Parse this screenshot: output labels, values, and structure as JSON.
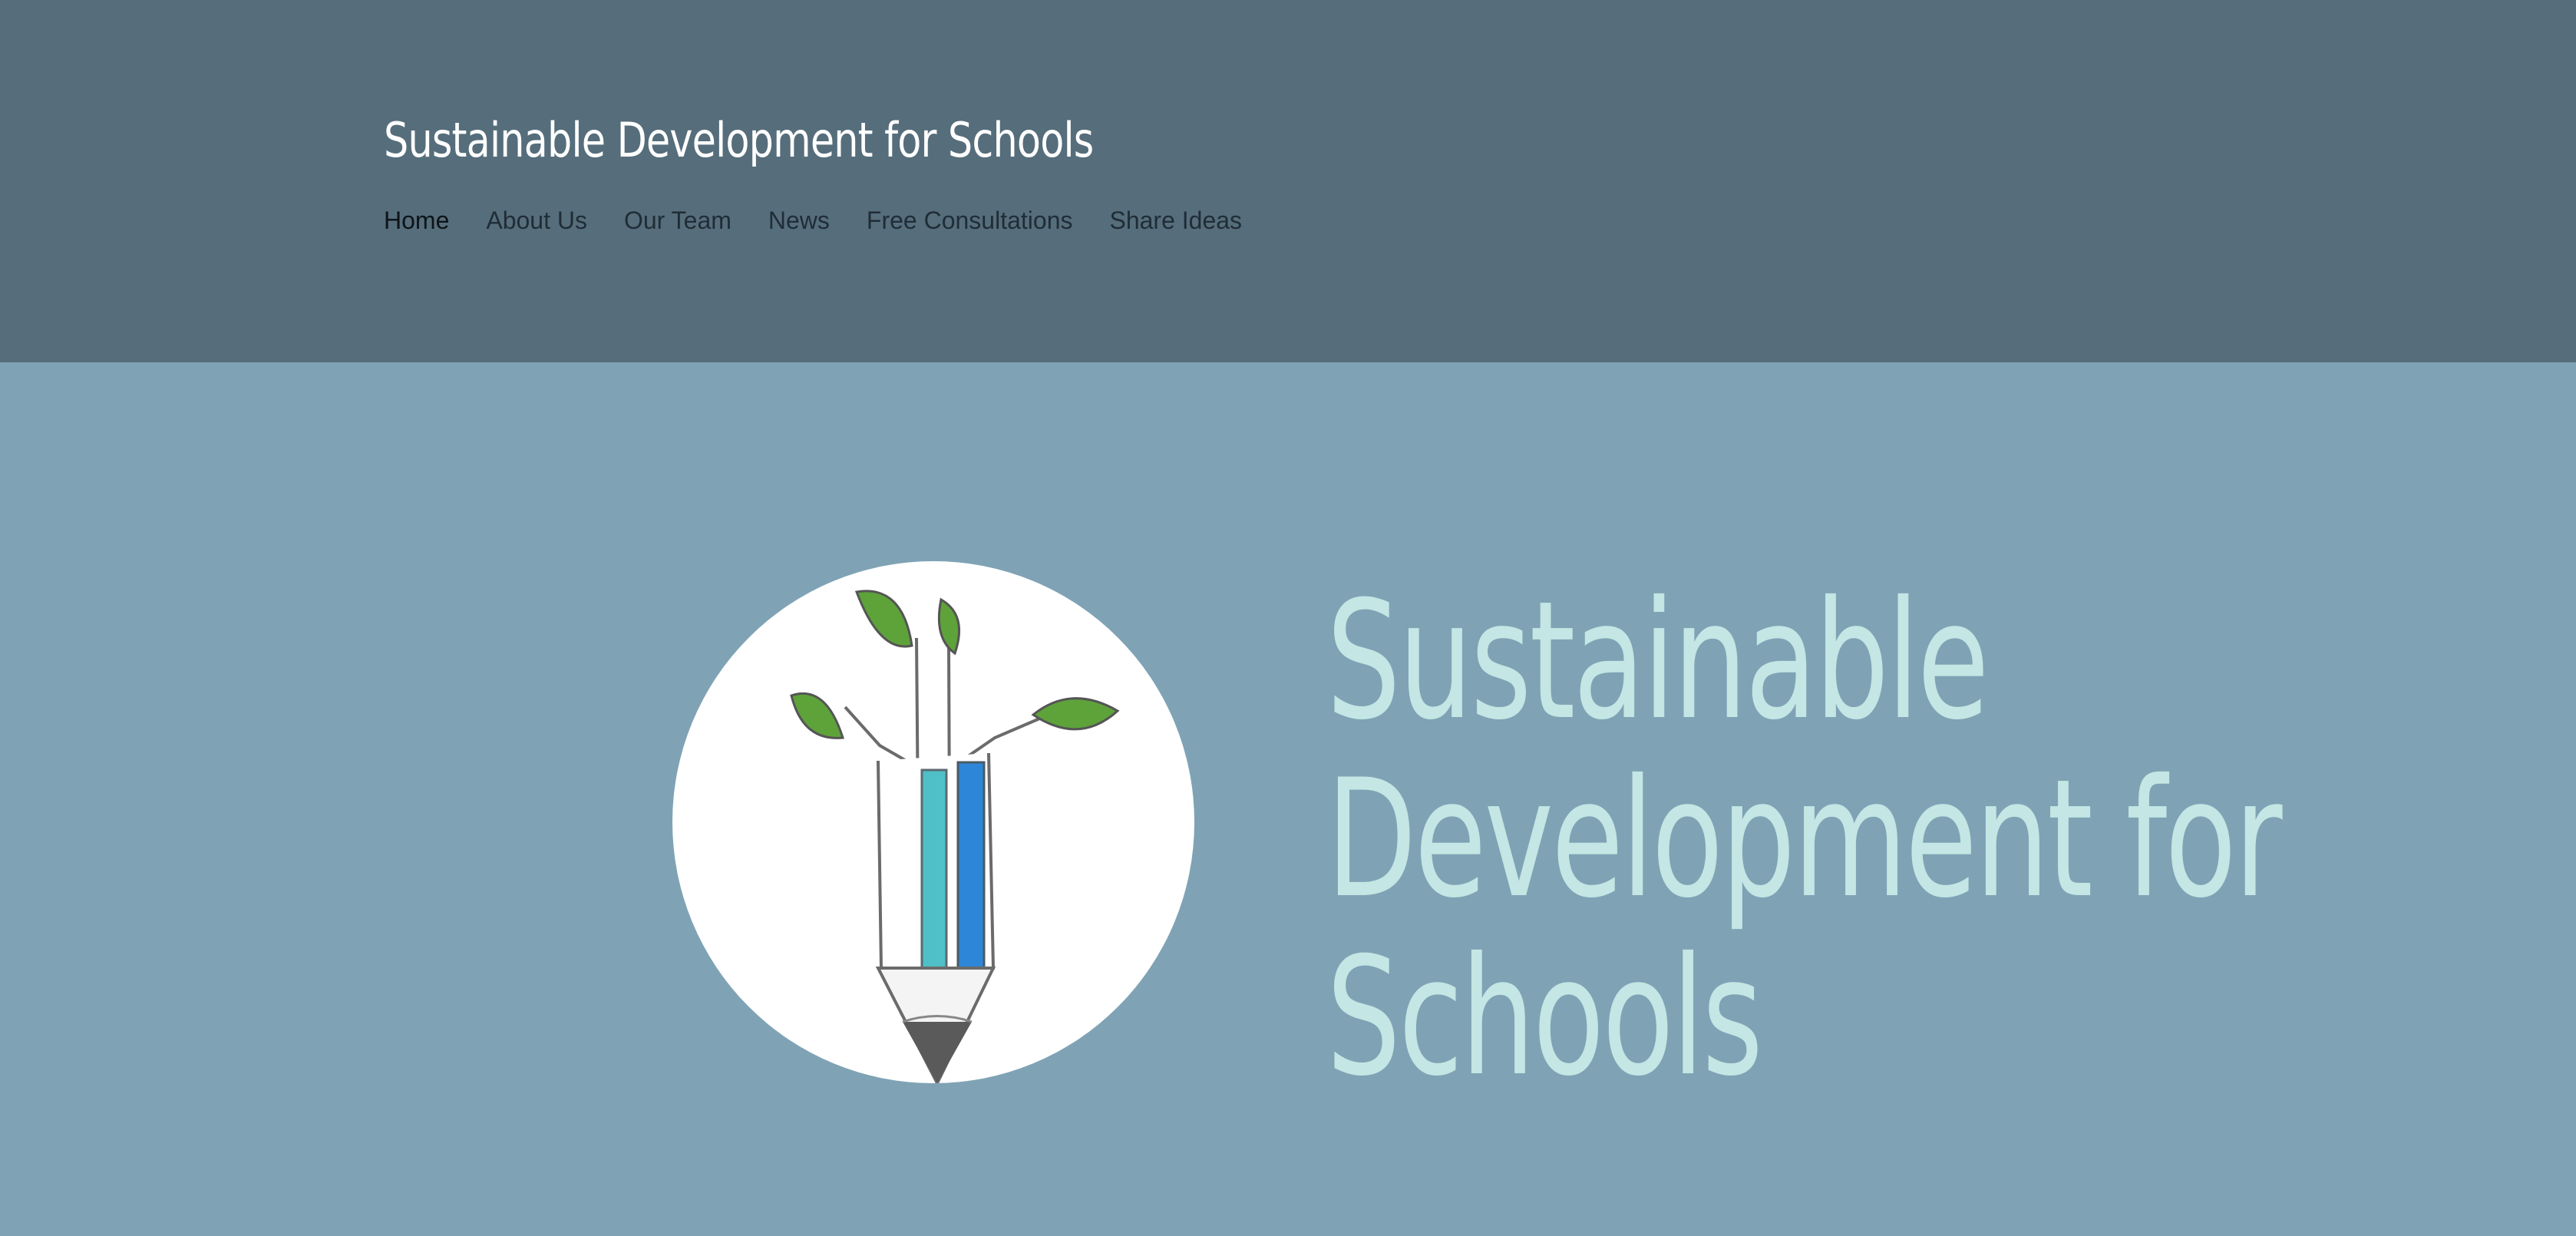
{
  "site": {
    "title": "Sustainable Development for Schools"
  },
  "nav": {
    "items": [
      {
        "label": "Home",
        "active": true
      },
      {
        "label": "About Us"
      },
      {
        "label": "Our Team"
      },
      {
        "label": "News"
      },
      {
        "label": "Free Consultations"
      },
      {
        "label": "Share Ideas"
      }
    ]
  },
  "hero": {
    "heading_lines": [
      "Sustainable",
      "Development for",
      "Schools"
    ],
    "logo_icon": "pencil-sprout-logo-icon"
  },
  "colors": {
    "header_bg": "#566d7b",
    "hero_bg": "#7fa3b5",
    "heading_text": "#c4e6e4",
    "title_text": "#ffffff",
    "nav_text": "#1f2d36"
  }
}
